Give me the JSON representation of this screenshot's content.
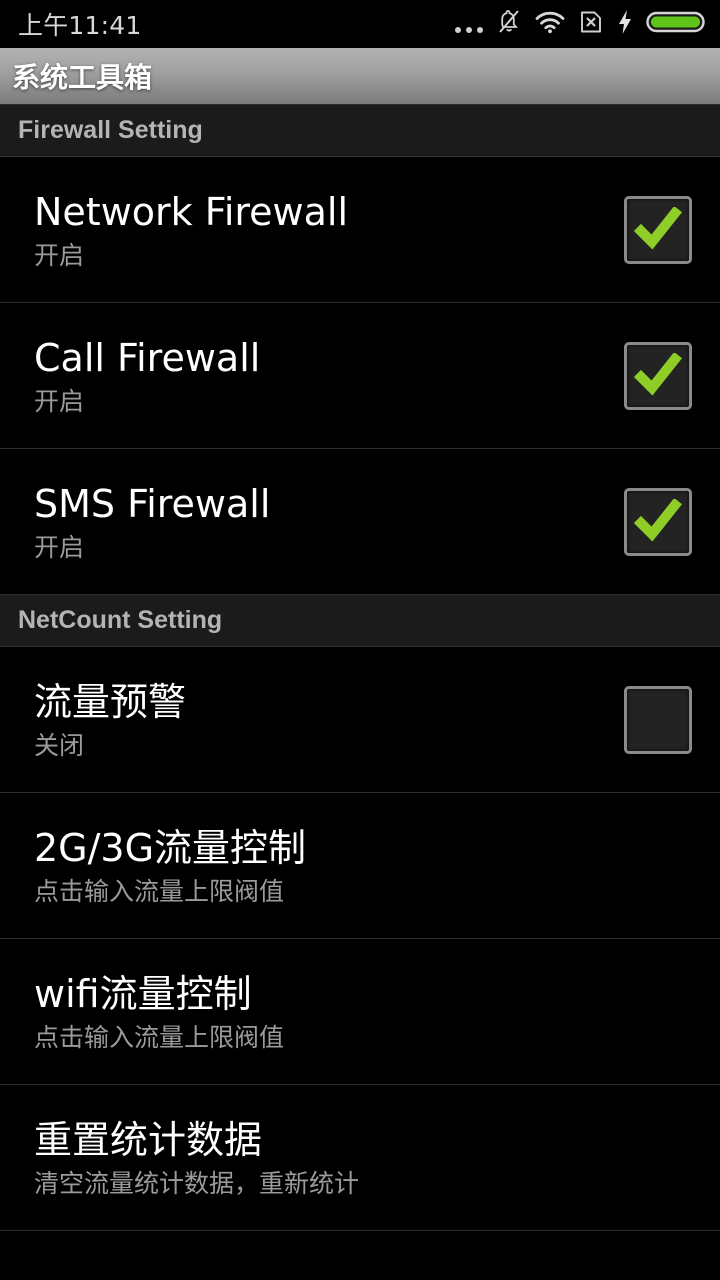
{
  "status_bar": {
    "time": "上午11:41",
    "icons": [
      {
        "name": "more-dots-icon"
      },
      {
        "name": "bell-muted-icon"
      },
      {
        "name": "wifi-icon"
      },
      {
        "name": "sim-missing-icon"
      },
      {
        "name": "charging-bolt-icon"
      },
      {
        "name": "battery-icon"
      }
    ],
    "battery_color": "#5ec41a"
  },
  "title_bar": {
    "title": "系统工具箱"
  },
  "colors": {
    "accent_green": "#8ece27",
    "title_text": "#ffffff",
    "subtitle_text": "#9a9a9a",
    "section_text": "#b4b4b4",
    "background": "#000000"
  },
  "sections": [
    {
      "header": "Firewall Setting",
      "items": [
        {
          "title": "Network Firewall",
          "subtitle": "开启",
          "control": "checkbox",
          "checked": true
        },
        {
          "title": "Call Firewall",
          "subtitle": "开启",
          "control": "checkbox",
          "checked": true
        },
        {
          "title": "SMS Firewall",
          "subtitle": "开启",
          "control": "checkbox",
          "checked": true
        }
      ]
    },
    {
      "header": "NetCount Setting",
      "items": [
        {
          "title": "流量预警",
          "subtitle": "关闭",
          "control": "checkbox",
          "checked": false
        },
        {
          "title": "2G/3G流量控制",
          "subtitle": "点击输入流量上限阀值",
          "control": "none",
          "checked": false
        },
        {
          "title": "wifi流量控制",
          "subtitle": "点击输入流量上限阀值",
          "control": "none",
          "checked": false
        },
        {
          "title": "重置统计数据",
          "subtitle": "清空流量统计数据，重新统计",
          "control": "none",
          "checked": false
        }
      ]
    }
  ]
}
